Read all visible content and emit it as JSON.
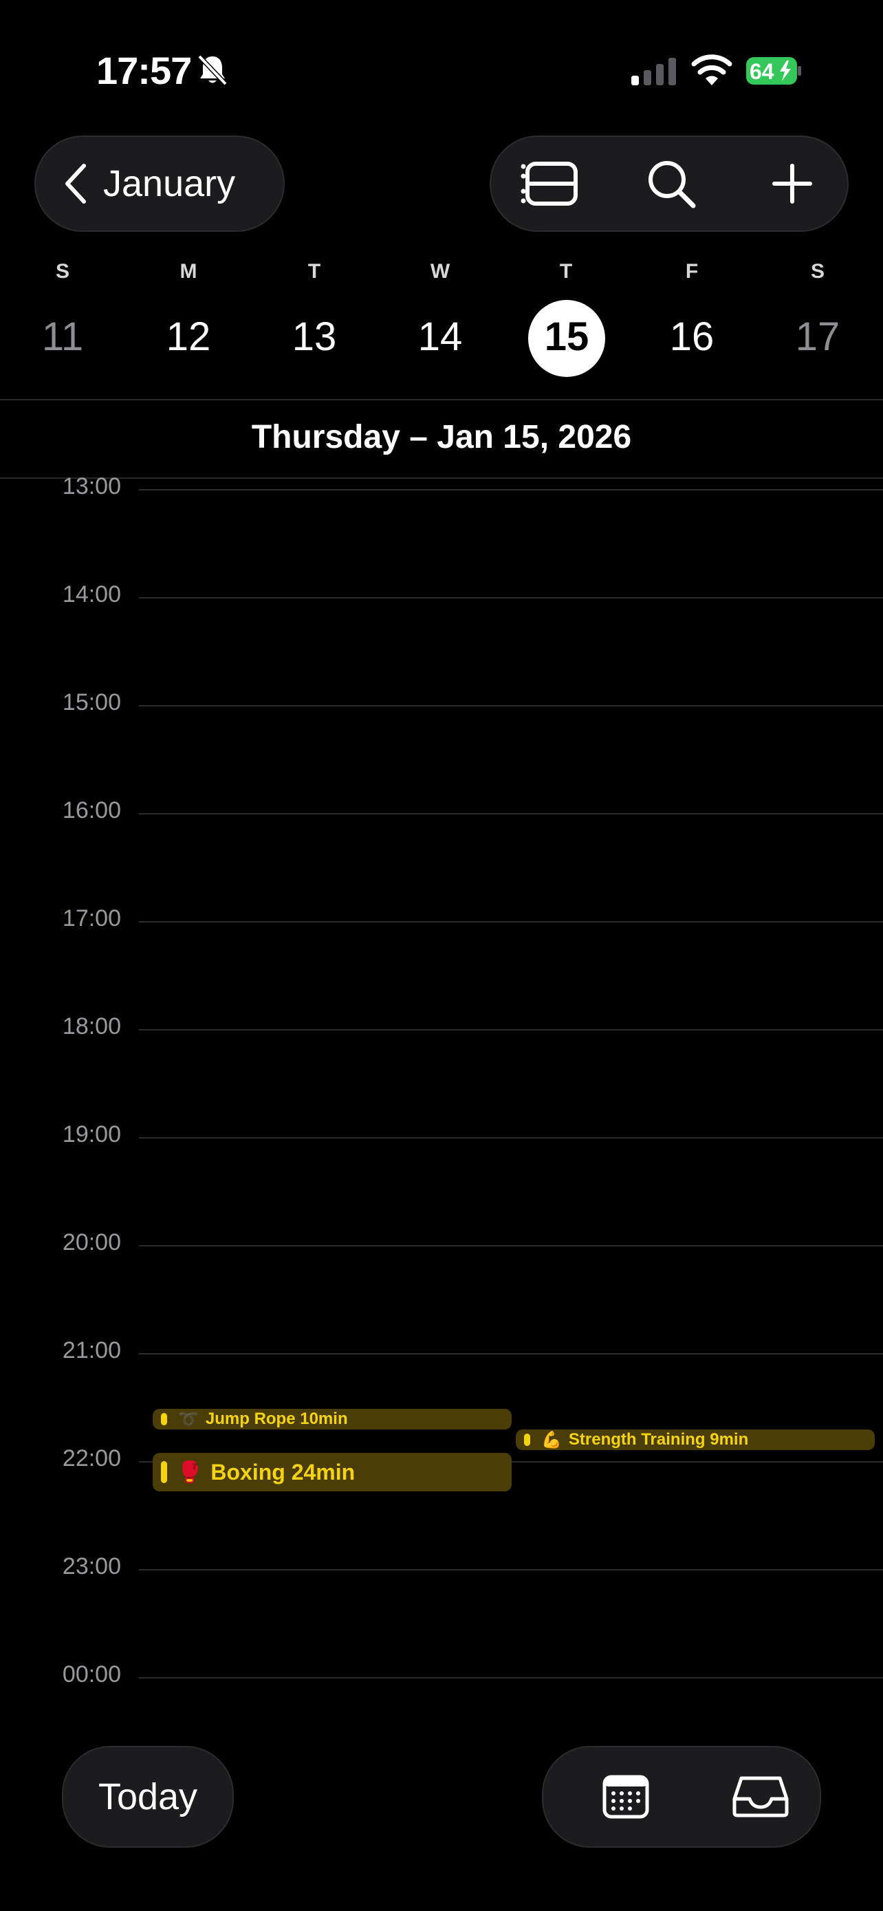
{
  "status_bar": {
    "time": "17:57",
    "battery": "64"
  },
  "nav": {
    "back_label": "January"
  },
  "week": {
    "day_letters": [
      "S",
      "M",
      "T",
      "W",
      "T",
      "F",
      "S"
    ],
    "dates": [
      "11",
      "12",
      "13",
      "14",
      "15",
      "16",
      "17"
    ],
    "selected_index": 4
  },
  "date_heading": "Thursday – Jan 15, 2026",
  "hours": [
    "13:00",
    "14:00",
    "15:00",
    "16:00",
    "17:00",
    "18:00",
    "19:00",
    "20:00",
    "21:00",
    "22:00",
    "23:00",
    "00:00"
  ],
  "events": [
    {
      "emoji": "➰",
      "title": "Jump Rope 10min"
    },
    {
      "emoji": "🥊",
      "title": "Boxing 24min"
    },
    {
      "emoji": "💪",
      "title": "Strength Training 9min"
    }
  ],
  "bottom": {
    "today_label": "Today"
  },
  "colors": {
    "event_bg": "#4a3d08",
    "event_text": "#f5d40f",
    "battery_green": "#34c759"
  }
}
